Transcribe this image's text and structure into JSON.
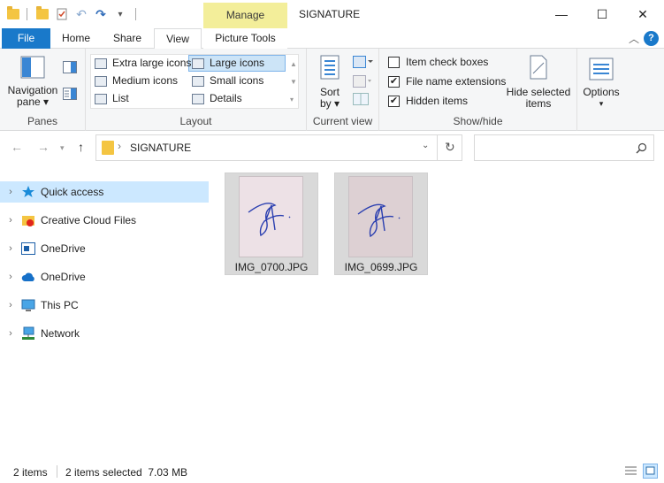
{
  "window": {
    "title": "SIGNATURE",
    "context_tab": "Manage",
    "minimize_glyph": "—",
    "maximize_glyph": "☐",
    "close_glyph": "✕"
  },
  "tabs": [
    {
      "label": "File"
    },
    {
      "label": "Home"
    },
    {
      "label": "Share"
    },
    {
      "label": "View"
    },
    {
      "label": "Picture Tools"
    }
  ],
  "ribbon": {
    "panes": {
      "nav_line1": "Navigation",
      "nav_line2": "pane ▾",
      "group": "Panes"
    },
    "layout": {
      "items": [
        "Extra large icons",
        "Large icons",
        "Medium icons",
        "Small icons",
        "List",
        "Details"
      ],
      "selected": "Large icons",
      "group": "Layout"
    },
    "current_view": {
      "sort_line1": "Sort",
      "sort_line2": "by ▾",
      "group": "Current view"
    },
    "show_hide": {
      "item_check_boxes": "Item check boxes",
      "file_name_extensions": "File name extensions",
      "hidden_items": "Hidden items",
      "hide_selected_line1": "Hide selected",
      "hide_selected_line2": "items",
      "group": "Show/hide"
    },
    "options": {
      "label": "Options",
      "arrow": "▾"
    }
  },
  "address": {
    "path": "SIGNATURE"
  },
  "nav_pane": [
    {
      "label": "Quick access",
      "icon": "star-icon"
    },
    {
      "label": "Creative Cloud Files",
      "icon": "creative-cloud-icon"
    },
    {
      "label": "OneDrive",
      "icon": "onedrive-folder-icon"
    },
    {
      "label": "OneDrive",
      "icon": "cloud-icon"
    },
    {
      "label": "This PC",
      "icon": "computer-icon"
    },
    {
      "label": "Network",
      "icon": "network-icon"
    }
  ],
  "files": [
    {
      "name": "IMG_0700.JPG"
    },
    {
      "name": "IMG_0699.JPG"
    }
  ],
  "status": {
    "count": "2 items",
    "selection": "2 items selected  7.03 MB"
  },
  "colors": {
    "accent": "#1979ca",
    "manage_tab": "#f3ee9a",
    "selection": "#cce8ff",
    "ink": "#2b3fb0"
  }
}
